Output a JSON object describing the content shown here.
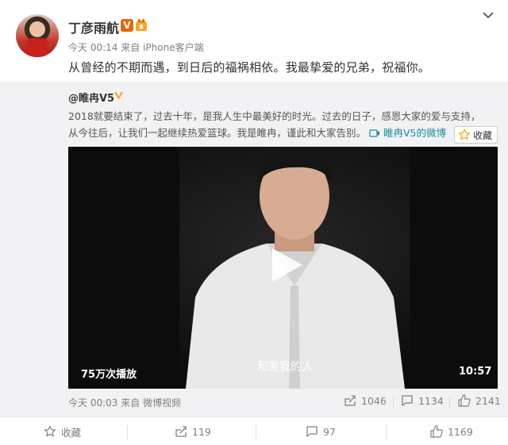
{
  "post": {
    "author": "丁彦雨航",
    "meta_time": "今天 00:14",
    "meta_from": "来自",
    "meta_source": "iPhone客户端",
    "text": "从曾经的不期而遇，到日后的福祸相依。我最挚爱的兄弟，祝福你。"
  },
  "repost": {
    "author": "@睢冉V5",
    "text_line1": "2018就要结束了，过去十年，是我人生中最美好的时光。过去的日子，感恩大家的爱与支持，",
    "text_line2": "从今往后，让我们一起继续热爱篮球。我是睢冉，谨此和大家告别。",
    "video_link": "睢冉V5的微博",
    "collect_tip": "收藏",
    "video": {
      "views": "75万次播放",
      "subtitle": "和爱我的人",
      "duration": "10:57"
    },
    "meta": "今天 00:03 来自 微博视频",
    "stats": {
      "reposts": "1046",
      "comments": "1134",
      "likes": "2141"
    }
  },
  "actions": {
    "collect": "收藏",
    "repost": "119",
    "comment": "97",
    "like": "1169"
  },
  "colors": {
    "accent_orange": "#e8650b",
    "link_teal": "#1a8ca1",
    "repost_bg": "#f2f2f5"
  }
}
